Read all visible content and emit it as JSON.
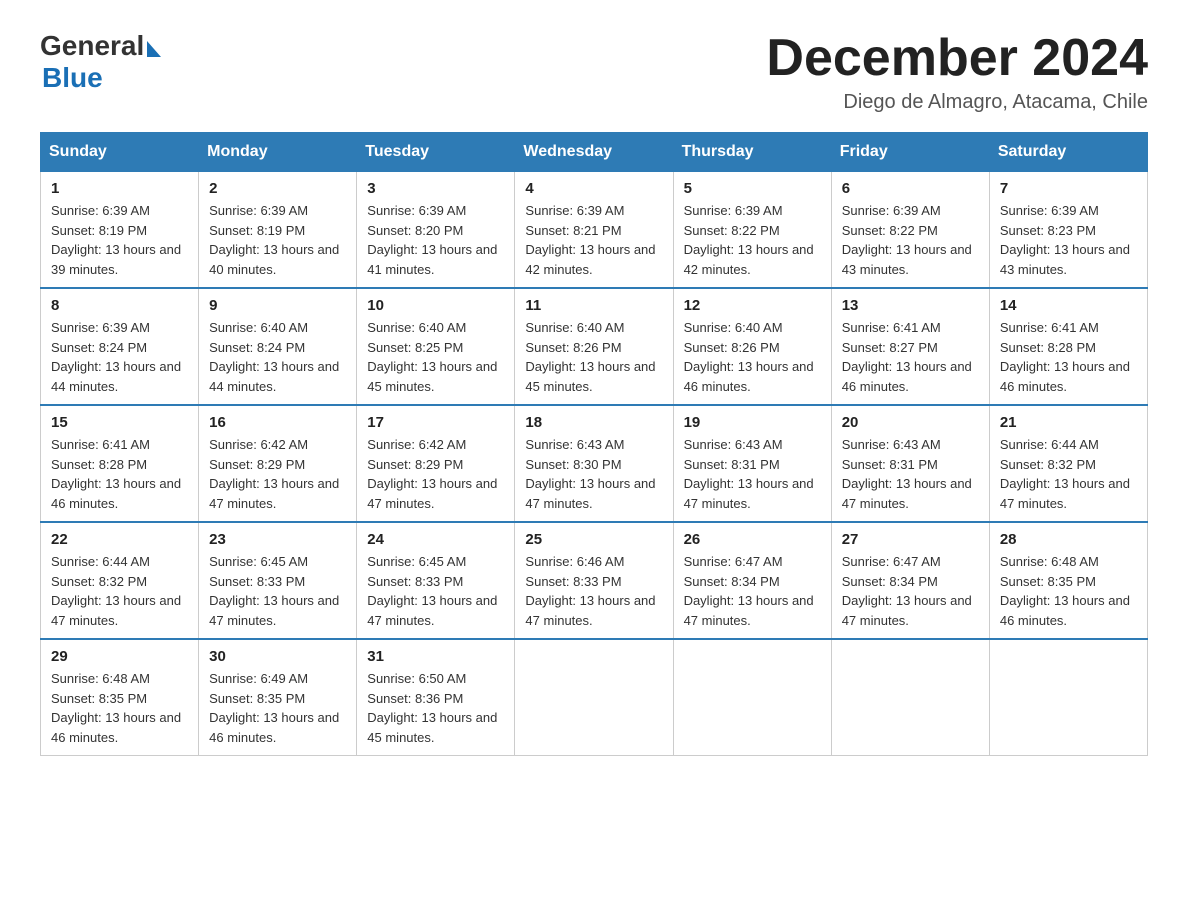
{
  "header": {
    "logo": {
      "general_text": "General",
      "blue_text": "Blue"
    },
    "title": "December 2024",
    "location": "Diego de Almagro, Atacama, Chile"
  },
  "calendar": {
    "days_of_week": [
      "Sunday",
      "Monday",
      "Tuesday",
      "Wednesday",
      "Thursday",
      "Friday",
      "Saturday"
    ],
    "weeks": [
      [
        {
          "day": "1",
          "sunrise": "6:39 AM",
          "sunset": "8:19 PM",
          "daylight": "13 hours and 39 minutes."
        },
        {
          "day": "2",
          "sunrise": "6:39 AM",
          "sunset": "8:19 PM",
          "daylight": "13 hours and 40 minutes."
        },
        {
          "day": "3",
          "sunrise": "6:39 AM",
          "sunset": "8:20 PM",
          "daylight": "13 hours and 41 minutes."
        },
        {
          "day": "4",
          "sunrise": "6:39 AM",
          "sunset": "8:21 PM",
          "daylight": "13 hours and 42 minutes."
        },
        {
          "day": "5",
          "sunrise": "6:39 AM",
          "sunset": "8:22 PM",
          "daylight": "13 hours and 42 minutes."
        },
        {
          "day": "6",
          "sunrise": "6:39 AM",
          "sunset": "8:22 PM",
          "daylight": "13 hours and 43 minutes."
        },
        {
          "day": "7",
          "sunrise": "6:39 AM",
          "sunset": "8:23 PM",
          "daylight": "13 hours and 43 minutes."
        }
      ],
      [
        {
          "day": "8",
          "sunrise": "6:39 AM",
          "sunset": "8:24 PM",
          "daylight": "13 hours and 44 minutes."
        },
        {
          "day": "9",
          "sunrise": "6:40 AM",
          "sunset": "8:24 PM",
          "daylight": "13 hours and 44 minutes."
        },
        {
          "day": "10",
          "sunrise": "6:40 AM",
          "sunset": "8:25 PM",
          "daylight": "13 hours and 45 minutes."
        },
        {
          "day": "11",
          "sunrise": "6:40 AM",
          "sunset": "8:26 PM",
          "daylight": "13 hours and 45 minutes."
        },
        {
          "day": "12",
          "sunrise": "6:40 AM",
          "sunset": "8:26 PM",
          "daylight": "13 hours and 46 minutes."
        },
        {
          "day": "13",
          "sunrise": "6:41 AM",
          "sunset": "8:27 PM",
          "daylight": "13 hours and 46 minutes."
        },
        {
          "day": "14",
          "sunrise": "6:41 AM",
          "sunset": "8:28 PM",
          "daylight": "13 hours and 46 minutes."
        }
      ],
      [
        {
          "day": "15",
          "sunrise": "6:41 AM",
          "sunset": "8:28 PM",
          "daylight": "13 hours and 46 minutes."
        },
        {
          "day": "16",
          "sunrise": "6:42 AM",
          "sunset": "8:29 PM",
          "daylight": "13 hours and 47 minutes."
        },
        {
          "day": "17",
          "sunrise": "6:42 AM",
          "sunset": "8:29 PM",
          "daylight": "13 hours and 47 minutes."
        },
        {
          "day": "18",
          "sunrise": "6:43 AM",
          "sunset": "8:30 PM",
          "daylight": "13 hours and 47 minutes."
        },
        {
          "day": "19",
          "sunrise": "6:43 AM",
          "sunset": "8:31 PM",
          "daylight": "13 hours and 47 minutes."
        },
        {
          "day": "20",
          "sunrise": "6:43 AM",
          "sunset": "8:31 PM",
          "daylight": "13 hours and 47 minutes."
        },
        {
          "day": "21",
          "sunrise": "6:44 AM",
          "sunset": "8:32 PM",
          "daylight": "13 hours and 47 minutes."
        }
      ],
      [
        {
          "day": "22",
          "sunrise": "6:44 AM",
          "sunset": "8:32 PM",
          "daylight": "13 hours and 47 minutes."
        },
        {
          "day": "23",
          "sunrise": "6:45 AM",
          "sunset": "8:33 PM",
          "daylight": "13 hours and 47 minutes."
        },
        {
          "day": "24",
          "sunrise": "6:45 AM",
          "sunset": "8:33 PM",
          "daylight": "13 hours and 47 minutes."
        },
        {
          "day": "25",
          "sunrise": "6:46 AM",
          "sunset": "8:33 PM",
          "daylight": "13 hours and 47 minutes."
        },
        {
          "day": "26",
          "sunrise": "6:47 AM",
          "sunset": "8:34 PM",
          "daylight": "13 hours and 47 minutes."
        },
        {
          "day": "27",
          "sunrise": "6:47 AM",
          "sunset": "8:34 PM",
          "daylight": "13 hours and 47 minutes."
        },
        {
          "day": "28",
          "sunrise": "6:48 AM",
          "sunset": "8:35 PM",
          "daylight": "13 hours and 46 minutes."
        }
      ],
      [
        {
          "day": "29",
          "sunrise": "6:48 AM",
          "sunset": "8:35 PM",
          "daylight": "13 hours and 46 minutes."
        },
        {
          "day": "30",
          "sunrise": "6:49 AM",
          "sunset": "8:35 PM",
          "daylight": "13 hours and 46 minutes."
        },
        {
          "day": "31",
          "sunrise": "6:50 AM",
          "sunset": "8:36 PM",
          "daylight": "13 hours and 45 minutes."
        },
        null,
        null,
        null,
        null
      ]
    ]
  }
}
